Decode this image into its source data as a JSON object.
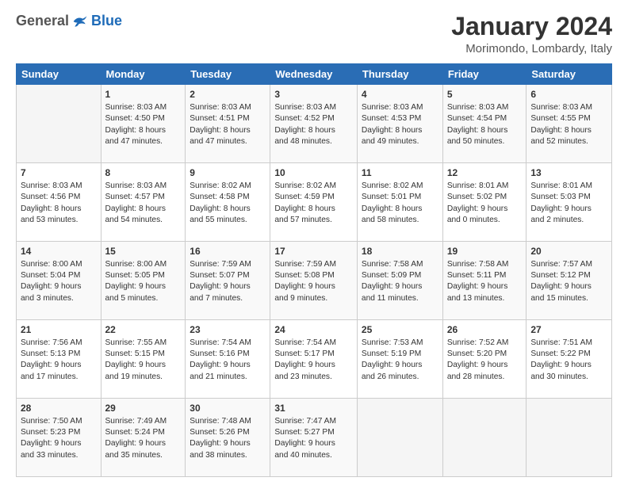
{
  "header": {
    "logo_general": "General",
    "logo_blue": "Blue",
    "month": "January 2024",
    "location": "Morimondo, Lombardy, Italy"
  },
  "columns": [
    "Sunday",
    "Monday",
    "Tuesday",
    "Wednesday",
    "Thursday",
    "Friday",
    "Saturday"
  ],
  "weeks": [
    [
      {
        "day": "",
        "lines": []
      },
      {
        "day": "1",
        "lines": [
          "Sunrise: 8:03 AM",
          "Sunset: 4:50 PM",
          "Daylight: 8 hours",
          "and 47 minutes."
        ]
      },
      {
        "day": "2",
        "lines": [
          "Sunrise: 8:03 AM",
          "Sunset: 4:51 PM",
          "Daylight: 8 hours",
          "and 47 minutes."
        ]
      },
      {
        "day": "3",
        "lines": [
          "Sunrise: 8:03 AM",
          "Sunset: 4:52 PM",
          "Daylight: 8 hours",
          "and 48 minutes."
        ]
      },
      {
        "day": "4",
        "lines": [
          "Sunrise: 8:03 AM",
          "Sunset: 4:53 PM",
          "Daylight: 8 hours",
          "and 49 minutes."
        ]
      },
      {
        "day": "5",
        "lines": [
          "Sunrise: 8:03 AM",
          "Sunset: 4:54 PM",
          "Daylight: 8 hours",
          "and 50 minutes."
        ]
      },
      {
        "day": "6",
        "lines": [
          "Sunrise: 8:03 AM",
          "Sunset: 4:55 PM",
          "Daylight: 8 hours",
          "and 52 minutes."
        ]
      }
    ],
    [
      {
        "day": "7",
        "lines": [
          "Sunrise: 8:03 AM",
          "Sunset: 4:56 PM",
          "Daylight: 8 hours",
          "and 53 minutes."
        ]
      },
      {
        "day": "8",
        "lines": [
          "Sunrise: 8:03 AM",
          "Sunset: 4:57 PM",
          "Daylight: 8 hours",
          "and 54 minutes."
        ]
      },
      {
        "day": "9",
        "lines": [
          "Sunrise: 8:02 AM",
          "Sunset: 4:58 PM",
          "Daylight: 8 hours",
          "and 55 minutes."
        ]
      },
      {
        "day": "10",
        "lines": [
          "Sunrise: 8:02 AM",
          "Sunset: 4:59 PM",
          "Daylight: 8 hours",
          "and 57 minutes."
        ]
      },
      {
        "day": "11",
        "lines": [
          "Sunrise: 8:02 AM",
          "Sunset: 5:01 PM",
          "Daylight: 8 hours",
          "and 58 minutes."
        ]
      },
      {
        "day": "12",
        "lines": [
          "Sunrise: 8:01 AM",
          "Sunset: 5:02 PM",
          "Daylight: 9 hours",
          "and 0 minutes."
        ]
      },
      {
        "day": "13",
        "lines": [
          "Sunrise: 8:01 AM",
          "Sunset: 5:03 PM",
          "Daylight: 9 hours",
          "and 2 minutes."
        ]
      }
    ],
    [
      {
        "day": "14",
        "lines": [
          "Sunrise: 8:00 AM",
          "Sunset: 5:04 PM",
          "Daylight: 9 hours",
          "and 3 minutes."
        ]
      },
      {
        "day": "15",
        "lines": [
          "Sunrise: 8:00 AM",
          "Sunset: 5:05 PM",
          "Daylight: 9 hours",
          "and 5 minutes."
        ]
      },
      {
        "day": "16",
        "lines": [
          "Sunrise: 7:59 AM",
          "Sunset: 5:07 PM",
          "Daylight: 9 hours",
          "and 7 minutes."
        ]
      },
      {
        "day": "17",
        "lines": [
          "Sunrise: 7:59 AM",
          "Sunset: 5:08 PM",
          "Daylight: 9 hours",
          "and 9 minutes."
        ]
      },
      {
        "day": "18",
        "lines": [
          "Sunrise: 7:58 AM",
          "Sunset: 5:09 PM",
          "Daylight: 9 hours",
          "and 11 minutes."
        ]
      },
      {
        "day": "19",
        "lines": [
          "Sunrise: 7:58 AM",
          "Sunset: 5:11 PM",
          "Daylight: 9 hours",
          "and 13 minutes."
        ]
      },
      {
        "day": "20",
        "lines": [
          "Sunrise: 7:57 AM",
          "Sunset: 5:12 PM",
          "Daylight: 9 hours",
          "and 15 minutes."
        ]
      }
    ],
    [
      {
        "day": "21",
        "lines": [
          "Sunrise: 7:56 AM",
          "Sunset: 5:13 PM",
          "Daylight: 9 hours",
          "and 17 minutes."
        ]
      },
      {
        "day": "22",
        "lines": [
          "Sunrise: 7:55 AM",
          "Sunset: 5:15 PM",
          "Daylight: 9 hours",
          "and 19 minutes."
        ]
      },
      {
        "day": "23",
        "lines": [
          "Sunrise: 7:54 AM",
          "Sunset: 5:16 PM",
          "Daylight: 9 hours",
          "and 21 minutes."
        ]
      },
      {
        "day": "24",
        "lines": [
          "Sunrise: 7:54 AM",
          "Sunset: 5:17 PM",
          "Daylight: 9 hours",
          "and 23 minutes."
        ]
      },
      {
        "day": "25",
        "lines": [
          "Sunrise: 7:53 AM",
          "Sunset: 5:19 PM",
          "Daylight: 9 hours",
          "and 26 minutes."
        ]
      },
      {
        "day": "26",
        "lines": [
          "Sunrise: 7:52 AM",
          "Sunset: 5:20 PM",
          "Daylight: 9 hours",
          "and 28 minutes."
        ]
      },
      {
        "day": "27",
        "lines": [
          "Sunrise: 7:51 AM",
          "Sunset: 5:22 PM",
          "Daylight: 9 hours",
          "and 30 minutes."
        ]
      }
    ],
    [
      {
        "day": "28",
        "lines": [
          "Sunrise: 7:50 AM",
          "Sunset: 5:23 PM",
          "Daylight: 9 hours",
          "and 33 minutes."
        ]
      },
      {
        "day": "29",
        "lines": [
          "Sunrise: 7:49 AM",
          "Sunset: 5:24 PM",
          "Daylight: 9 hours",
          "and 35 minutes."
        ]
      },
      {
        "day": "30",
        "lines": [
          "Sunrise: 7:48 AM",
          "Sunset: 5:26 PM",
          "Daylight: 9 hours",
          "and 38 minutes."
        ]
      },
      {
        "day": "31",
        "lines": [
          "Sunrise: 7:47 AM",
          "Sunset: 5:27 PM",
          "Daylight: 9 hours",
          "and 40 minutes."
        ]
      },
      {
        "day": "",
        "lines": []
      },
      {
        "day": "",
        "lines": []
      },
      {
        "day": "",
        "lines": []
      }
    ]
  ]
}
